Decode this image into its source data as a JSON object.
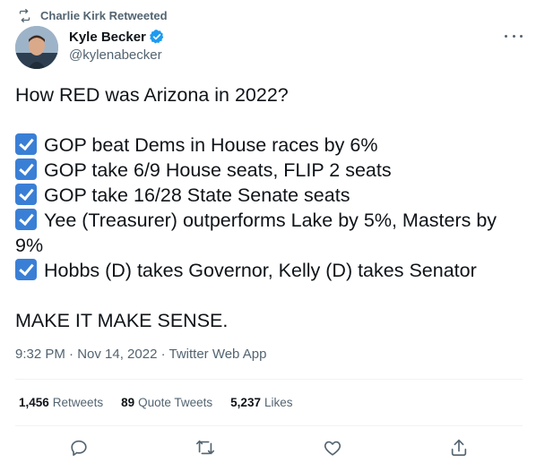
{
  "social_context": {
    "text": "Charlie Kirk Retweeted",
    "icon": "retweet-icon"
  },
  "author": {
    "display_name": "Kyle Becker",
    "handle": "@kylenabecker",
    "verified_icon": "verified-badge-icon"
  },
  "tweet": {
    "headline": "How RED was Arizona in 2022?",
    "items": [
      "GOP beat Dems in House races by 6%",
      "GOP take 6/9 House seats, FLIP 2 seats",
      "GOP take 16/28 State Senate seats",
      "Yee (Treasurer) outperforms Lake by 5%, Masters by 9%",
      "Hobbs (D) takes Governor, Kelly (D) takes Senator"
    ],
    "closing": "MAKE IT MAKE SENSE."
  },
  "meta": {
    "text": "9:32 PM · Nov 14, 2022 · Twitter Web App"
  },
  "stats": [
    {
      "count": "1,456",
      "label": "Retweets"
    },
    {
      "count": "89",
      "label": "Quote Tweets"
    },
    {
      "count": "5,237",
      "label": "Likes"
    }
  ],
  "actions": [
    "reply-icon",
    "retweet-icon",
    "like-icon",
    "share-icon"
  ],
  "colors": {
    "text": "#0f1419",
    "secondary": "#536471",
    "accent": "#1d9bf0",
    "divider": "#eff3f4",
    "check": "#3a7fd6"
  }
}
